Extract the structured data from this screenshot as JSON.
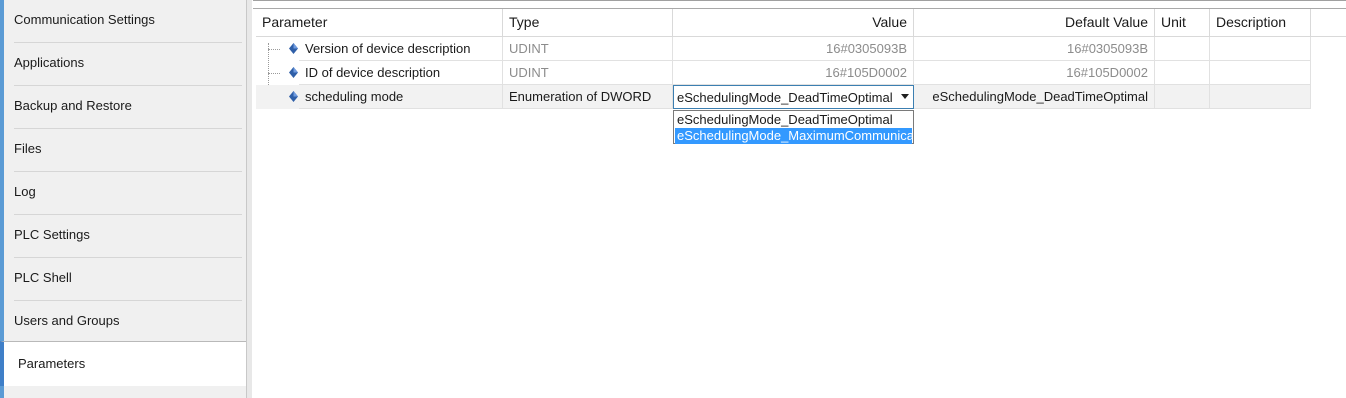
{
  "sidebar": {
    "items": [
      {
        "label": "Communication Settings"
      },
      {
        "label": "Applications"
      },
      {
        "label": "Backup and Restore"
      },
      {
        "label": "Files"
      },
      {
        "label": "Log"
      },
      {
        "label": "PLC Settings"
      },
      {
        "label": "PLC Shell"
      },
      {
        "label": "Users and Groups"
      },
      {
        "label": "Parameters",
        "active": true
      }
    ]
  },
  "table": {
    "columns": [
      "Parameter",
      "Type",
      "Value",
      "Default Value",
      "Unit",
      "Description"
    ],
    "rows": [
      {
        "parameter": "Version of device description",
        "type": "UDINT",
        "value": "16#0305093B",
        "default": "16#0305093B",
        "unit": "",
        "description": ""
      },
      {
        "parameter": "ID of device description",
        "type": "UDINT",
        "value": "16#105D0002",
        "default": "16#105D0002",
        "unit": "",
        "description": ""
      },
      {
        "parameter": "scheduling mode",
        "type": "Enumeration of DWORD",
        "value": "eSchedulingMode_DeadTimeOptimal",
        "default": "eSchedulingMode_DeadTimeOptimal",
        "unit": "",
        "description": ""
      }
    ]
  },
  "dropdown": {
    "selected": "eSchedulingMode_DeadTimeOptimal",
    "options": [
      "eSchedulingMode_DeadTimeOptimal",
      "eSchedulingMode_MaximumCommunicati"
    ],
    "highlighted_index": 1
  },
  "colors": {
    "accent": "#3f7fc8",
    "highlight": "#3399ff",
    "sidebar_bg": "#f0f0f0",
    "readonly_text": "#8c8c8c"
  },
  "icons": {
    "parameter": "parameter-diamond-icon",
    "dropdown_arrow": "chevron-down-icon"
  }
}
